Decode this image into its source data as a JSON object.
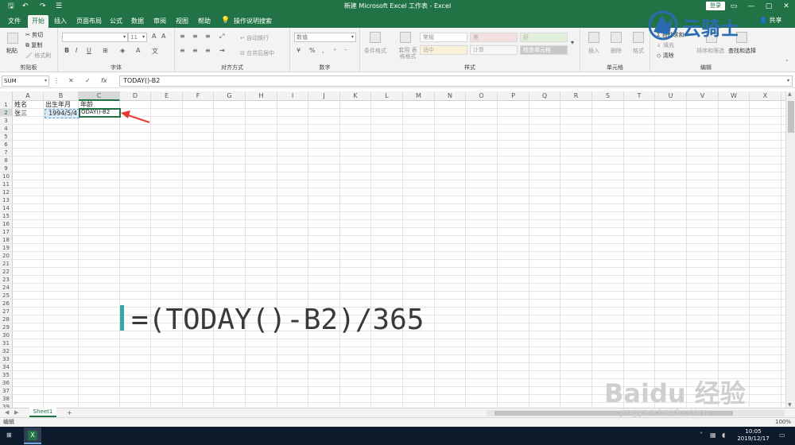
{
  "window": {
    "title": "新建 Microsoft Excel 工作表  -  Excel",
    "login_label": "登录",
    "controls": [
      "—",
      "▢",
      "✕"
    ]
  },
  "quick_access": [
    "save-icon",
    "undo-icon",
    "redo-icon",
    "customize-icon"
  ],
  "tabs": [
    {
      "label": "文件",
      "active": false
    },
    {
      "label": "开始",
      "active": true
    },
    {
      "label": "插入",
      "active": false
    },
    {
      "label": "页面布局",
      "active": false
    },
    {
      "label": "公式",
      "active": false
    },
    {
      "label": "数据",
      "active": false
    },
    {
      "label": "审阅",
      "active": false
    },
    {
      "label": "视图",
      "active": false
    },
    {
      "label": "帮助",
      "active": false
    }
  ],
  "tell_me": "操作说明搜索",
  "share": "共享",
  "ribbon": {
    "clipboard": {
      "paste": "粘贴",
      "cut": "剪切",
      "copy": "复制",
      "format_painter": "格式刷",
      "label": "剪贴板"
    },
    "font": {
      "size": "11",
      "label": "字体"
    },
    "alignment": {
      "wrap": "自动换行",
      "merge": "合并后居中",
      "label": "对齐方式"
    },
    "number": {
      "format": "数值",
      "label": "数字"
    },
    "styles": {
      "conditional": "条件格式",
      "table": "套用 表格格式",
      "cells": [
        "常规",
        "差",
        "好",
        "适中",
        "计算",
        "检查单元格"
      ],
      "label": "样式"
    },
    "cells": {
      "insert": "插入",
      "delete": "删除",
      "format": "格式",
      "label": "单元格"
    },
    "editing": {
      "autosum": "自动求和",
      "fill": "填充",
      "clear": "清除",
      "sort": "排序和筛选",
      "find": "查找和选择",
      "label": "编辑"
    }
  },
  "formula_bar": {
    "name_box": "SUM",
    "cancel": "✕",
    "enter": "✓",
    "fx": "fx",
    "formula": "TODAY()-B2"
  },
  "columns": [
    "A",
    "B",
    "C",
    "D",
    "E",
    "F",
    "G",
    "H",
    "I",
    "J",
    "K",
    "L",
    "M",
    "N",
    "O",
    "P",
    "Q",
    "R",
    "S",
    "T",
    "U",
    "V",
    "W",
    "X"
  ],
  "rows": [
    "1",
    "2",
    "3",
    "4",
    "5",
    "6",
    "7",
    "8",
    "9",
    "10",
    "11",
    "12",
    "13",
    "14",
    "15",
    "16",
    "17",
    "18",
    "19",
    "20",
    "21",
    "22",
    "23",
    "24",
    "25",
    "26",
    "27",
    "28",
    "29",
    "30",
    "31",
    "32",
    "33",
    "34",
    "35",
    "36",
    "37",
    "38",
    "39"
  ],
  "cells": {
    "A1": "姓名",
    "B1": "出生年月",
    "C1": "年龄",
    "A2": "张三",
    "B2": "1994/5/4",
    "C2": "ODAY()-B2"
  },
  "overlay_formula": "=(TODAY()-B2)/365",
  "sheet_tab": "Sheet1",
  "add_sheet": "+",
  "status": {
    "mode": "编辑",
    "zoom": "100%"
  },
  "clock": {
    "time": "10:05",
    "date": "2019/12/17"
  },
  "watermarks": {
    "top": "云骑士",
    "bottom_brand": "Baidu 经验",
    "bottom_url": "jingyan.baidu.com"
  },
  "colors": {
    "accent": "#217346",
    "arrow": "#e53935",
    "overlay_bar": "#3aa6a6"
  }
}
